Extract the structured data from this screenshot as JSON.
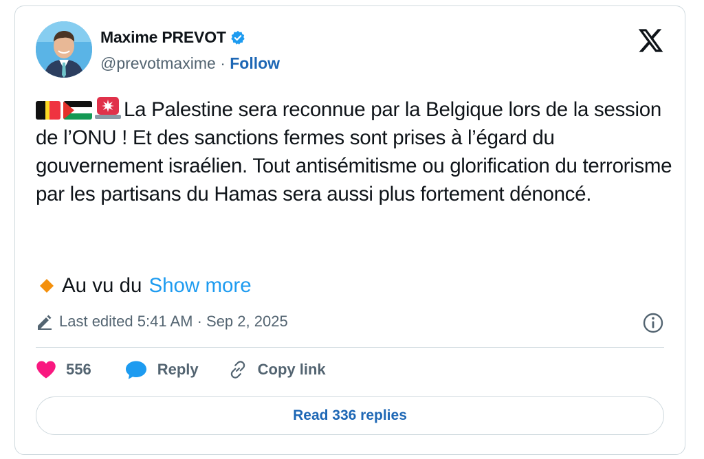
{
  "author": {
    "name": "Maxime PREVOT",
    "handle": "@prevotmaxime",
    "separator": "·",
    "follow_label": "Follow"
  },
  "post": {
    "emojis": [
      "belgium-flag-icon",
      "palestine-flag-icon",
      "police-light-icon"
    ],
    "text": "La Palestine sera reconnue par la Belgique lors de la session de l’ONU ! Et des sanctions fermes sont prises à l’égard du gouvernement israélien. Tout antisémitisme ou glorification du terrorisme par les partisans du Hamas sera aussi plus fortement dénoncé.",
    "continuation": "Au vu du",
    "show_more_label": "Show more",
    "edited_label": "Last edited 5:41 AM · Sep 2, 2025"
  },
  "actions": {
    "likes_count": "556",
    "reply_label": "Reply",
    "copy_link_label": "Copy link",
    "read_replies_label": "Read 336 replies"
  },
  "colors": {
    "link": "#1d67b5",
    "show_more": "#1d9bf0",
    "like": "#f91880",
    "reply_icon": "#1d9bf0",
    "verified": "#1d9bf0"
  }
}
